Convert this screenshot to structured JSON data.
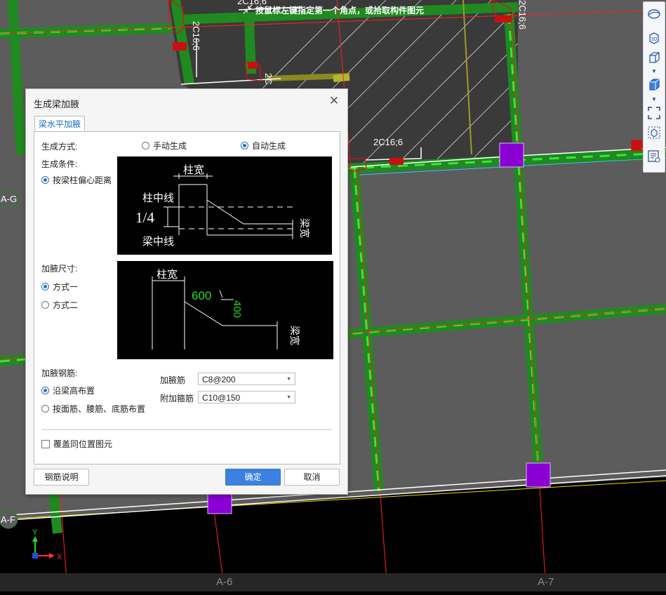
{
  "drawing": {
    "axis_labels_left": [
      "A-G",
      "A-F"
    ],
    "axis_labels_bottom": [
      "A-6",
      "A-7"
    ],
    "beam_annotations": [
      "2C16;6",
      "2C16;6",
      "2C16;6",
      "2C",
      "2C16;6"
    ],
    "coord_x": "X",
    "coord_y": "Y"
  },
  "toolbar": {
    "icons": [
      "sphere-icon",
      "3d-view-icon",
      "cube-icon",
      "cube-solid-icon",
      "fit-view-icon",
      "box-select-icon",
      "layer-list-icon"
    ]
  },
  "status": {
    "prompt": "按鼠标左键指定第一个角点，或拾取构件图元"
  },
  "dialog": {
    "title": "生成梁加腋",
    "tab": "梁水平加腋",
    "gen_mode_label": "生成方式:",
    "gen_mode_options": [
      "手动生成",
      "自动生成"
    ],
    "gen_mode_selected": "自动生成",
    "condition_label": "生成条件:",
    "condition_option": "按梁柱偏心距离",
    "diagram1": {
      "col_width": "柱宽",
      "col_center": "柱中线",
      "ratio": "1/4",
      "beam_center": "梁中线",
      "beam_width": "梁宽"
    },
    "size_label": "加腋尺寸:",
    "size_options": [
      "方式一",
      "方式二"
    ],
    "size_selected": "方式一",
    "diagram2": {
      "col_width": "柱宽",
      "len": "600",
      "height": "400",
      "beam_width": "梁宽"
    },
    "rebar_label": "加腋钢筋:",
    "rebar_options": [
      "沿梁高布置",
      "按面筋、腰筋、底筋布置"
    ],
    "rebar_selected": "沿梁高布置",
    "haunch_bar_label": "加腋筋",
    "haunch_bar_value": "C8@200",
    "stirrup_label": "附加箍筋",
    "stirrup_value": "C10@150",
    "overwrite_label": "覆盖同位置图元",
    "overwrite_checked": false,
    "btn_explain": "钢筋说明",
    "btn_ok": "确定",
    "btn_cancel": "取消"
  },
  "colors": {
    "beam_green": "#1f8a1f",
    "column_purple": "#8a00d4",
    "axis_red": "#ff2020",
    "dialog_accent": "#3b82e0"
  }
}
